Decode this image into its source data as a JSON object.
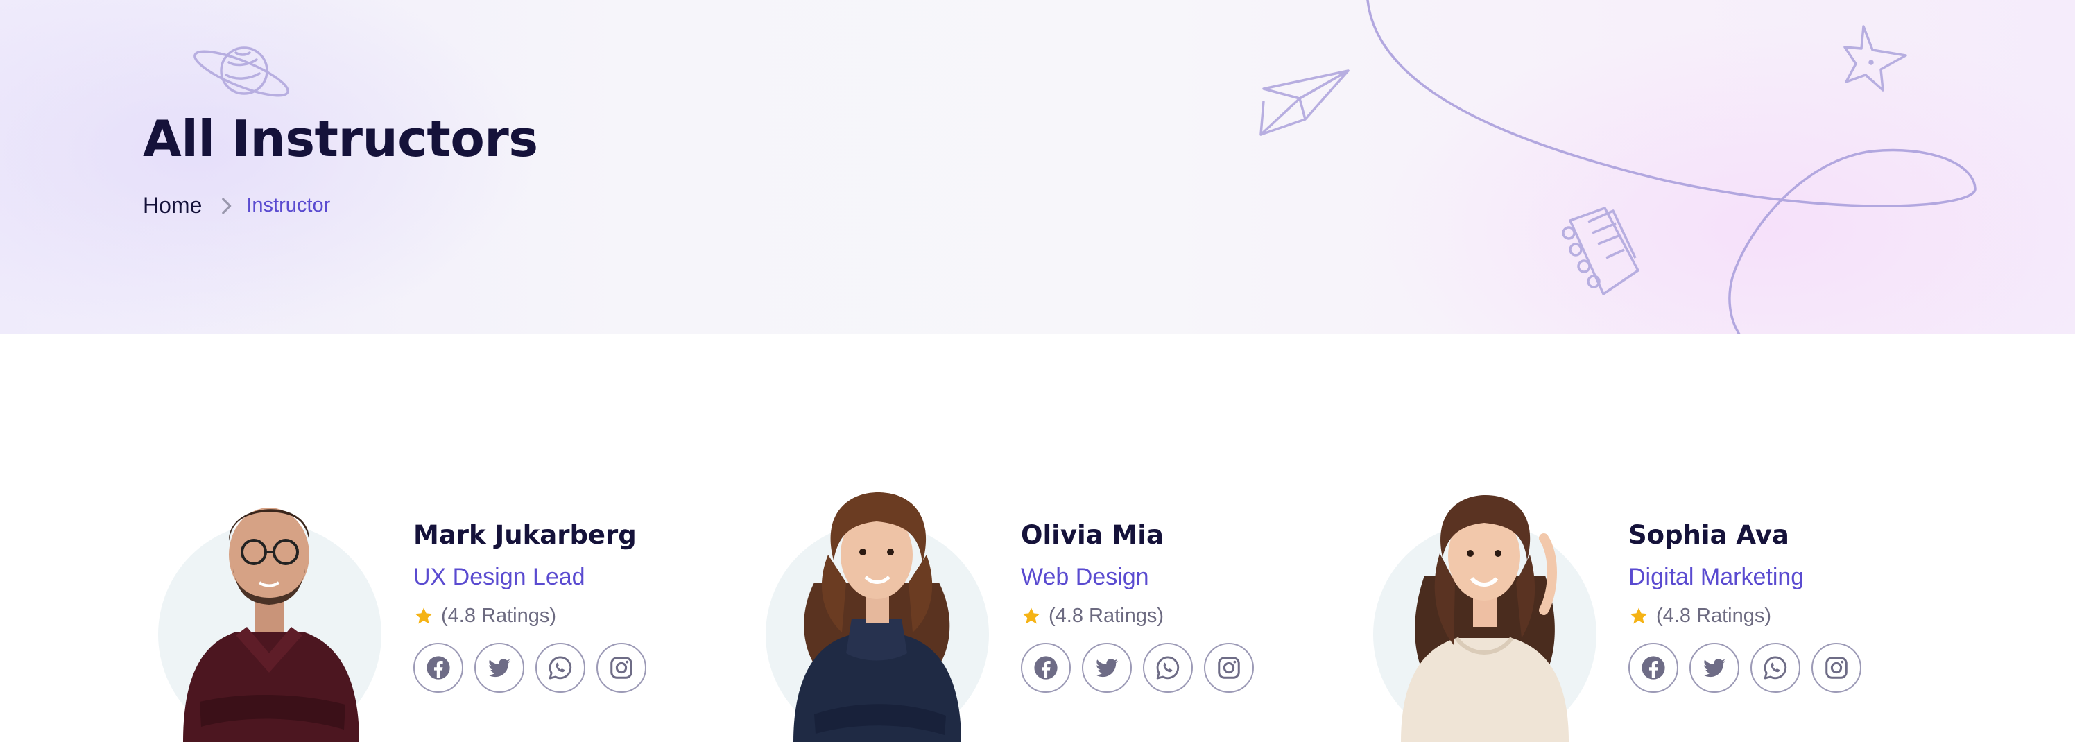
{
  "hero": {
    "title": "All Instructors",
    "breadcrumb": {
      "home": "Home",
      "current": "Instructor"
    },
    "decorations": [
      "planet-icon",
      "paper-plane-icon",
      "star-doodle-icon",
      "notebook-icon",
      "curly-line-doodle"
    ]
  },
  "colors": {
    "accent": "#5a4bd0",
    "heading": "#15123a",
    "muted": "#6c6a80",
    "star": "#f5b315",
    "doodle": "#b7aee0"
  },
  "instructors": [
    {
      "name": "Mark Jukarberg",
      "role": "UX Design Lead",
      "rating": "(4.8 Ratings)",
      "socials": [
        "facebook-icon",
        "twitter-icon",
        "whatsapp-icon",
        "instagram-icon"
      ]
    },
    {
      "name": "Olivia Mia",
      "role": "Web Design",
      "rating": "(4.8 Ratings)",
      "socials": [
        "facebook-icon",
        "twitter-icon",
        "whatsapp-icon",
        "instagram-icon"
      ]
    },
    {
      "name": "Sophia Ava",
      "role": "Digital Marketing",
      "rating": "(4.8 Ratings)",
      "socials": [
        "facebook-icon",
        "twitter-icon",
        "whatsapp-icon",
        "instagram-icon"
      ]
    }
  ]
}
